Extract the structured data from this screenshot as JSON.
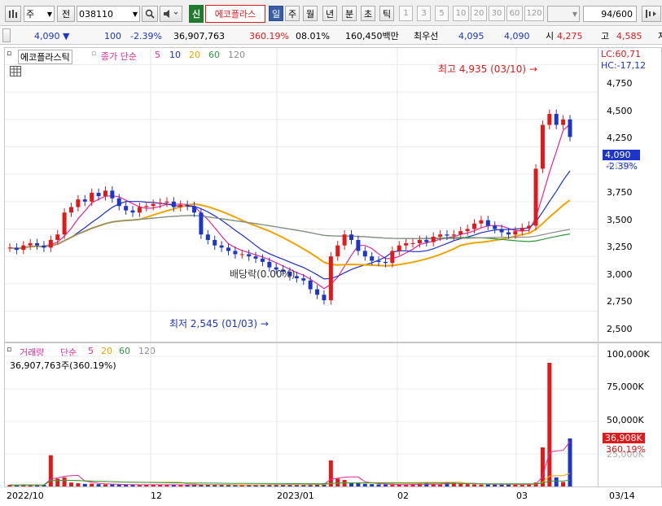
{
  "toolbar": {
    "market": "주",
    "all_button": "전",
    "code": "038110",
    "name_badge": "신",
    "name": "에코플라스",
    "periods": [
      "일",
      "주",
      "월",
      "년",
      "분",
      "초",
      "틱"
    ],
    "intervals": [
      "1",
      "3",
      "5",
      "10",
      "20",
      "30",
      "60",
      "120"
    ],
    "count": "94",
    "count_total": "/600"
  },
  "quote": {
    "price": "4,090",
    "change_arrow": "▼",
    "change": "100",
    "change_pct": "-2.39%",
    "volume": "36,907,763",
    "vol_ratio": "360.19%",
    "turnover_pct": "08.01%",
    "amount": "160,450백만",
    "best_label": "최우선",
    "bid": "4,095",
    "ask": "4,090",
    "open_label": "시",
    "open": "4,275",
    "high_label": "고",
    "high": "4,585",
    "low_label": "저"
  },
  "price_panel": {
    "title": "에코플라스틱",
    "ma_label": "종가 단순",
    "ma_periods": [
      "5",
      "10",
      "20",
      "60",
      "120"
    ],
    "lc": "LC:60,71",
    "hc": "HC:-17,12",
    "price_tag": "4,090",
    "pct_tag": "-2.39%",
    "high_note": "최고 4,935 (03/10) →",
    "low_note": "최저 2,545 (01/03) →",
    "dividend_note": "배당락(0.00%)",
    "y_ticks": [
      "4,750",
      "4,500",
      "4,250",
      "4,000",
      "3,750",
      "3,500",
      "3,250",
      "3,000",
      "2,750",
      "2,500"
    ]
  },
  "volume_panel": {
    "title": "거래량",
    "ma_label": "단순",
    "ma_periods": [
      "5",
      "20",
      "60",
      "120"
    ],
    "info": "36,907,763주(360.19%)",
    "vol_tag": "36,908K",
    "pct_tag": "360.19%",
    "y_ticks": [
      "100,000K",
      "75,000K",
      "50,000K",
      "25,000K"
    ]
  },
  "x_axis": {
    "labels": [
      "2022/10",
      "12",
      "2023/01",
      "02",
      "03",
      "03/14"
    ]
  },
  "chart_data": {
    "type": "candlestick",
    "up_color": "#e0191a",
    "down_color": "#1d35c8",
    "y_range": [
      2400,
      5000
    ],
    "ma_colors": {
      "5": "#e2289c",
      "10": "#1c2ecc",
      "20": "#f0a400",
      "60": "#2b9a3c",
      "120": "#8c8c8c"
    },
    "price_series": [
      3080,
      3060,
      3100,
      3120,
      3100,
      3080,
      3150,
      3200,
      3400,
      3450,
      3520,
      3500,
      3580,
      3550,
      3600,
      3530,
      3460,
      3420,
      3400,
      3450,
      3460,
      3480,
      3490,
      3500,
      3450,
      3470,
      3460,
      3400,
      3200,
      3150,
      3100,
      3080,
      3050,
      3020,
      3020,
      3000,
      2980,
      2950,
      2900,
      2880,
      2860,
      2820,
      2800,
      2780,
      2700,
      2650,
      2600,
      3000,
      3100,
      3200,
      3150,
      3050,
      3000,
      2960,
      2950,
      2940,
      3050,
      3100,
      3120,
      3120,
      3150,
      3130,
      3180,
      3200,
      3190,
      3200,
      3230,
      3250,
      3300,
      3330,
      3280,
      3250,
      3220,
      3200,
      3230,
      3260,
      3280,
      3800,
      4200,
      4300,
      4200,
      4250,
      4090
    ],
    "volume_series": [
      1200,
      1100,
      1500,
      1000,
      900,
      1300,
      24000,
      6000,
      7000,
      3000,
      2500,
      2000,
      2200,
      1800,
      1600,
      1500,
      1400,
      1300,
      1200,
      1100,
      1500,
      1600,
      1300,
      1200,
      1100,
      1000,
      1200,
      1400,
      1800,
      1500,
      1300,
      1200,
      1000,
      900,
      1100,
      1200,
      1300,
      1400,
      1600,
      1500,
      1400,
      1300,
      1200,
      1100,
      1800,
      2000,
      2500,
      20000,
      6000,
      5000,
      3000,
      2500,
      2000,
      1800,
      1600,
      1500,
      1400,
      1300,
      1200,
      1800,
      2000,
      2200,
      1600,
      1400,
      3500,
      3000,
      2500,
      1800,
      1500,
      1400,
      1600,
      1700,
      1800,
      1500,
      1300,
      1200,
      2000,
      3000,
      30000,
      95000,
      7000,
      3500,
      36908
    ]
  }
}
